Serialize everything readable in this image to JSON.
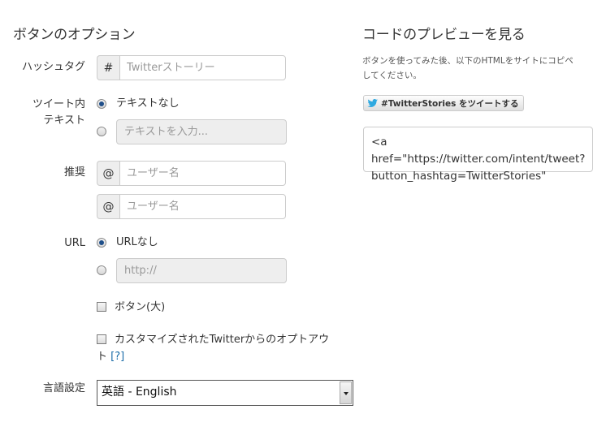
{
  "left": {
    "heading": "ボタンのオプション",
    "hashtag": {
      "label": "ハッシュタグ",
      "addon": "#",
      "placeholder": "Twitterストーリー"
    },
    "tweet_text": {
      "label_line1": "ツイート内",
      "label_line2": "テキスト",
      "option_none": "テキストなし",
      "input_placeholder": "テキストを入力..."
    },
    "recommend": {
      "label": "推奨",
      "addon": "@",
      "placeholder1": "ユーザー名",
      "placeholder2": "ユーザー名"
    },
    "url": {
      "label": "URL",
      "option_none": "URLなし",
      "input_placeholder": "http://"
    },
    "large_button": {
      "label": "ボタン(大)"
    },
    "opt_out": {
      "label_line1": "カスタマイズされたTwitterからのオプトアウ",
      "label_line2_prefix": "ト ",
      "help_link": "[?]"
    },
    "language": {
      "label": "言語設定",
      "selected": "英語 - English"
    }
  },
  "right": {
    "heading": "コードのプレビューを見る",
    "description": "ボタンを使ってみた後、以下のHTMLをサイトにコピペしてください。",
    "tweet_button": {
      "label": "#TwitterStories をツイートする",
      "icon": "twitter-bird-icon",
      "icon_color": "#2fa9e0"
    },
    "code": "<a href=\"https://twitter.com/intent/tweet?button_hashtag=TwitterStories\""
  }
}
